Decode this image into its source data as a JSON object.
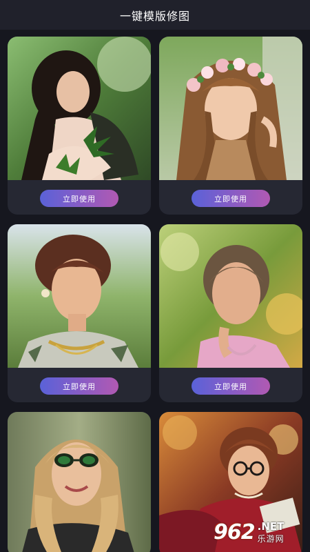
{
  "header": {
    "title": "一键模版修图"
  },
  "templates": [
    {
      "button_label": "立即使用",
      "image": "woman-sitting-in-foliage"
    },
    {
      "button_label": "立即使用",
      "image": "woman-with-flower-crown"
    },
    {
      "button_label": "立即使用",
      "image": "woman-with-updo-and-necklace"
    },
    {
      "button_label": "立即使用",
      "image": "smiling-woman-in-garden"
    },
    {
      "button_label": "",
      "image": "blonde-woman-with-sunglasses"
    },
    {
      "button_label": "",
      "image": "woman-with-glasses-reading"
    }
  ],
  "watermark": {
    "number": "962",
    "suffix": ".NET",
    "cn": "乐游网"
  },
  "colors": {
    "background": "#16171f",
    "header": "#20212b",
    "card": "#262833",
    "button_gradient": [
      "#5a62d8",
      "#b159b2"
    ]
  }
}
